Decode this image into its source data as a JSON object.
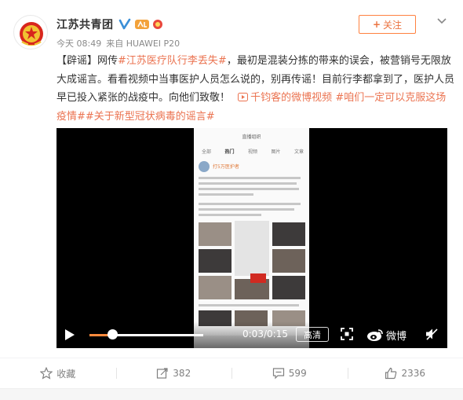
{
  "user": {
    "name": "江苏共青团",
    "avatar_icon": "communist-youth-league-emblem",
    "verified_icon": "verified-v-icon"
  },
  "meta": {
    "time": "今天 08:49",
    "source": "来自 HUAWEI P20"
  },
  "follow_button": {
    "plus": "+",
    "label": "关注"
  },
  "post": {
    "tag": "【辟谣】",
    "prefix": "网传",
    "topic_link": "#江苏医疗队行李丢失#",
    "text1": "，最初是混装分拣的带来的误会，被营销号无限放大成谣言。看看视频中当事医护人员怎么说的，别再传谣！目前行李都拿到了，医护人员早已投入紧张的战疫中。向他们致敬！",
    "video_link": "千钧客的微博视频",
    "hashtag2": "#咱们一定可以克服这场疫情#",
    "hashtag3": "#关于新型冠状病毒的谣言#"
  },
  "video": {
    "phone_title": "直播组织",
    "phone_tabs": [
      "全部",
      "热门",
      "视频",
      "图片",
      "文章"
    ],
    "phone_active_tab": "热门",
    "phone_username": "打5万医护者",
    "current_time": "0:03",
    "duration": "0:15",
    "time_sep": "/",
    "progress": 0.2,
    "hd_label": "高清",
    "brand_label": "微博"
  },
  "actions": {
    "favorite_label": "收藏",
    "repost_count": "382",
    "comment_count": "599",
    "like_count": "2336"
  },
  "colors": {
    "link": "#eb7350",
    "follow_border": "#ff8140",
    "progress": "#ff8a3d"
  }
}
